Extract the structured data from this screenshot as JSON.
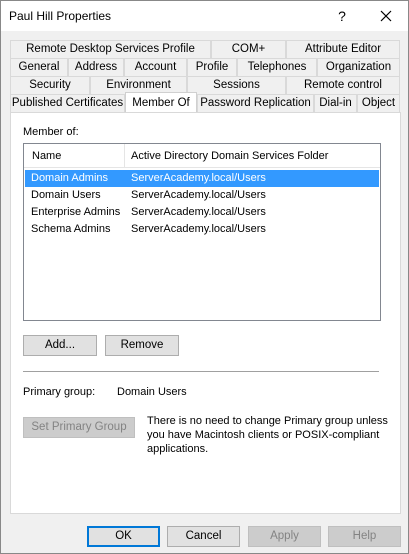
{
  "window": {
    "title": "Paul Hill Properties",
    "help_label": "?",
    "close_icon": "close-icon"
  },
  "tabs": {
    "row1": [
      "Remote Desktop Services Profile",
      "COM+",
      "Attribute Editor"
    ],
    "row2": [
      "General",
      "Address",
      "Account",
      "Profile",
      "Telephones",
      "Organization"
    ],
    "row3": [
      "Security",
      "Environment",
      "Sessions",
      "Remote control"
    ],
    "row4": [
      "Published Certificates",
      "Member Of",
      "Password Replication",
      "Dial-in",
      "Object"
    ],
    "active": "Member Of"
  },
  "member_of": {
    "label": "Member of:",
    "columns": [
      "Name",
      "Active Directory Domain Services Folder"
    ],
    "rows": [
      {
        "name": "Domain Admins",
        "folder": "ServerAcademy.local/Users",
        "selected": true
      },
      {
        "name": "Domain Users",
        "folder": "ServerAcademy.local/Users",
        "selected": false
      },
      {
        "name": "Enterprise Admins",
        "folder": "ServerAcademy.local/Users",
        "selected": false
      },
      {
        "name": "Schema Admins",
        "folder": "ServerAcademy.local/Users",
        "selected": false
      }
    ],
    "add_label": "Add...",
    "remove_label": "Remove"
  },
  "primary_group": {
    "label": "Primary group:",
    "value": "Domain Users",
    "set_button_label": "Set Primary Group",
    "note": "There is no need to change Primary group unless\nyou have Macintosh clients or POSIX-compliant\napplications."
  },
  "footer": {
    "ok_label": "OK",
    "cancel_label": "Cancel",
    "apply_label": "Apply",
    "help_label": "Help"
  },
  "colors": {
    "selection": "#3399ff",
    "default_button_border": "#0078d7",
    "window_bg": "#f0f0f0"
  }
}
